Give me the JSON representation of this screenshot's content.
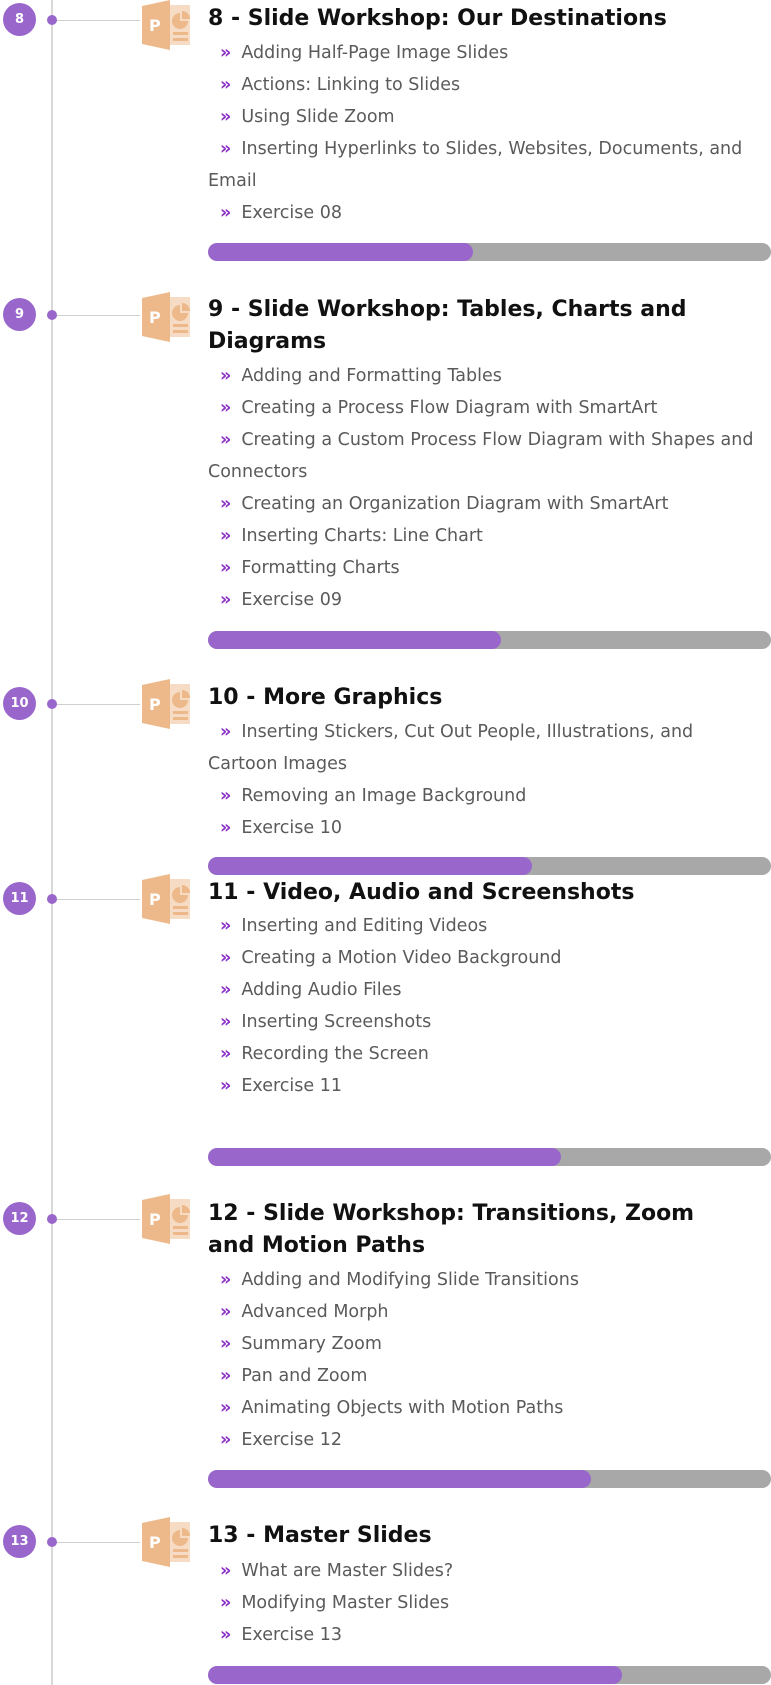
{
  "theme": {
    "accent": "#9966cc",
    "chevron": "#8a2fc8",
    "icon": "#edb98a",
    "track": "#a8a8a8"
  },
  "modules": [
    {
      "number": "8",
      "title": "8 - Slide Workshop: Our Destinations",
      "icon": "powerpoint-icon",
      "lessons": [
        "Adding Half-Page Image Slides",
        "Actions: Linking to Slides",
        "Using Slide Zoom",
        "Inserting Hyperlinks to Slides, Websites, Documents, and Email",
        "Exercise 08"
      ],
      "progress_fraction": 0.47
    },
    {
      "number": "9",
      "title": "9 - Slide Workshop: Tables, Charts and Diagrams",
      "icon": "powerpoint-icon",
      "lessons": [
        "Adding and Formatting Tables",
        "Creating a Process Flow Diagram with SmartArt",
        "Creating a Custom Process Flow Diagram with Shapes and Connectors",
        "Creating an Organization Diagram with SmartArt",
        "Inserting Charts: Line Chart",
        "Formatting Charts",
        "Exercise 09"
      ],
      "progress_fraction": 0.52
    },
    {
      "number": "10",
      "title": "10 - More Graphics",
      "icon": "powerpoint-icon",
      "lessons": [
        "Inserting Stickers, Cut Out People, Illustrations, and Cartoon Images",
        "Removing an Image Background",
        "Exercise 10"
      ],
      "progress_fraction": 0.575
    },
    {
      "number": "11",
      "title": "11 - Video, Audio and Screenshots",
      "icon": "powerpoint-icon",
      "lessons": [
        "Inserting and Editing Videos",
        "Creating a Motion Video Background",
        "Adding Audio Files",
        "Inserting Screenshots",
        "Recording the Screen",
        "Exercise 11"
      ],
      "progress_fraction": 0.627
    },
    {
      "number": "12",
      "title": "12 - Slide Workshop: Transitions, Zoom and Motion Paths",
      "icon": "powerpoint-icon",
      "lessons": [
        "Adding and Modifying Slide Transitions",
        "Advanced Morph",
        "Summary Zoom",
        "Pan and Zoom",
        "Animating Objects with Motion Paths",
        "Exercise 12"
      ],
      "progress_fraction": 0.68
    },
    {
      "number": "13",
      "title": "13 - Master Slides",
      "icon": "powerpoint-icon",
      "lessons": [
        "What are Master Slides?",
        "Modifying Master Slides",
        "Exercise 13"
      ],
      "progress_fraction": 0.735
    }
  ]
}
